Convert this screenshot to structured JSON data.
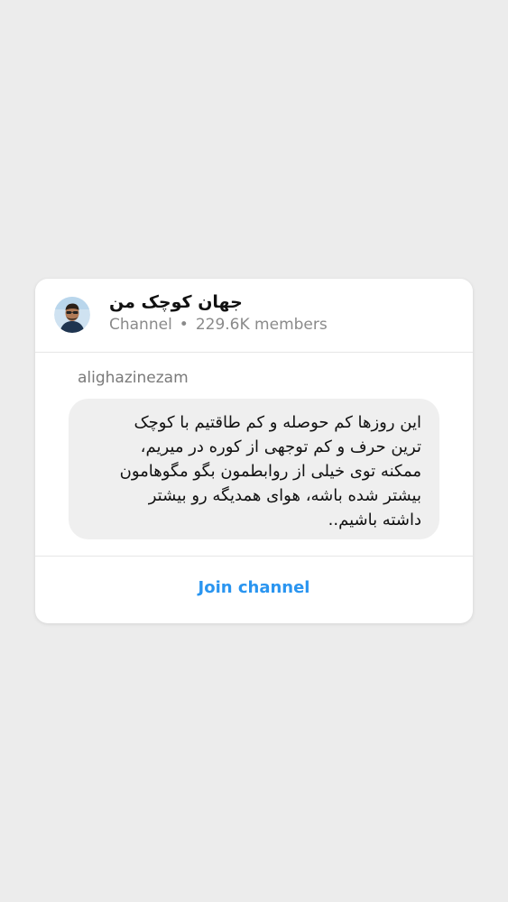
{
  "channel": {
    "name": "جهان کوچک من",
    "type_label": "Channel",
    "separator": "•",
    "member_count": "229.6K members",
    "avatar": "person-portrait-icon"
  },
  "post": {
    "sender": "alighazinezam",
    "message_lines": [
      "این روزها کم حوصله و کم طاقتیم با کوچک",
      "ترین حرف و کم توجهی از کوره در میریم،",
      "ممکنه توی خیلی از روابطمون بگو مگوهامون",
      "بیشتر شده باشه، هوای همدیگه رو بیشتر",
      "داشته باشیم.."
    ]
  },
  "actions": {
    "join_label": "Join channel"
  },
  "colors": {
    "background": "#ececec",
    "card": "#ffffff",
    "bubble": "#efefef",
    "accent": "#2a95f0",
    "muted_text": "#8a8a8a"
  }
}
